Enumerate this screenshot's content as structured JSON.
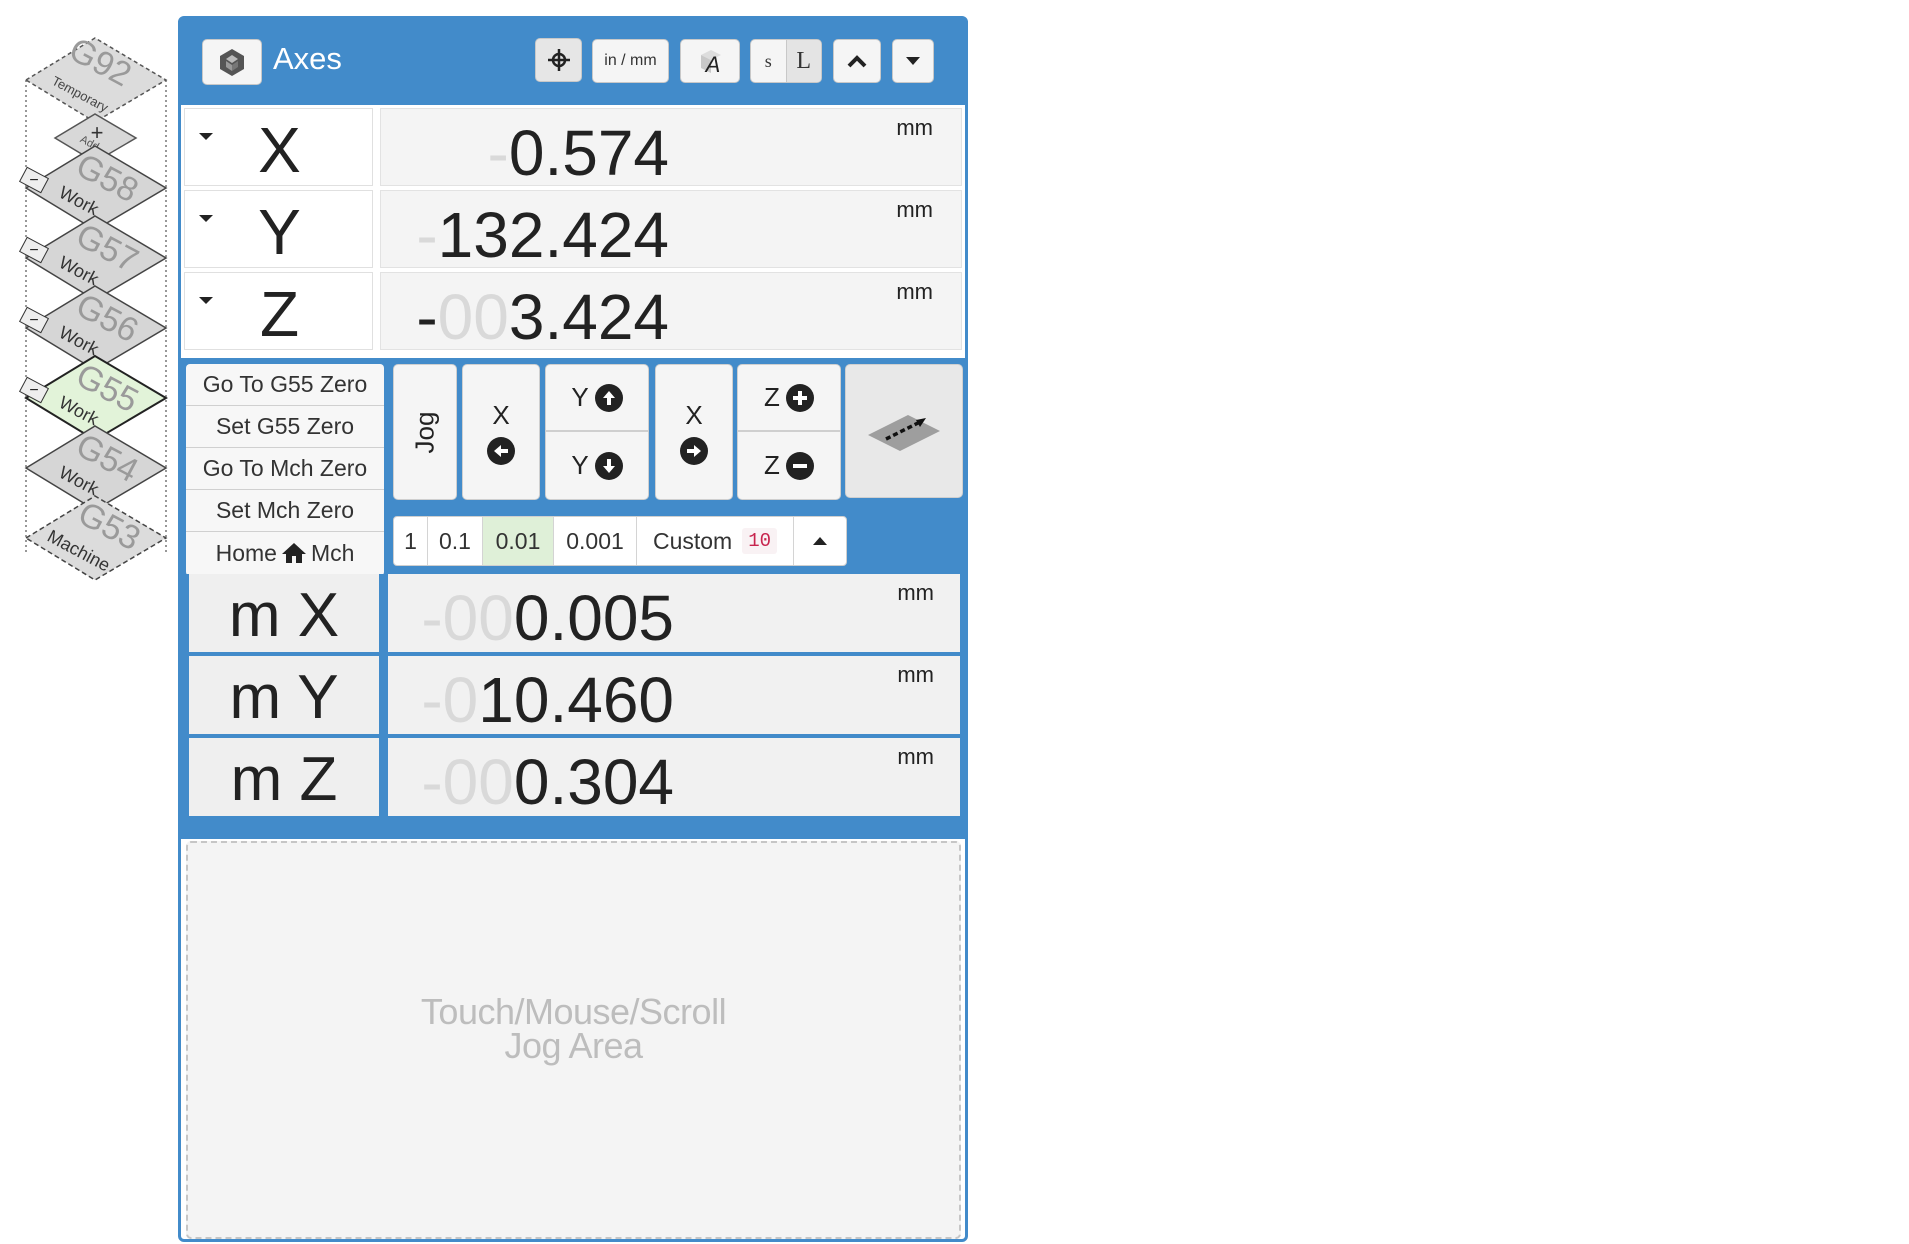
{
  "header": {
    "title": "Axes",
    "units_label": "in / mm",
    "size_small": "s",
    "size_large": "L"
  },
  "offset_stack": [
    {
      "code": "G92",
      "label": "Temporary",
      "style": "dashed"
    },
    {
      "code": "+",
      "label": "Add",
      "style": "add"
    },
    {
      "code": "G58",
      "label": "Work",
      "style": "work"
    },
    {
      "code": "G57",
      "label": "Work",
      "style": "work"
    },
    {
      "code": "G56",
      "label": "Work",
      "style": "work"
    },
    {
      "code": "G55",
      "label": "Work",
      "style": "active"
    },
    {
      "code": "G54",
      "label": "Work",
      "style": "work"
    },
    {
      "code": "G53",
      "label": "Machine",
      "style": "dashed"
    }
  ],
  "work_axes": [
    {
      "name": "X",
      "prefix": "-",
      "value": "0.574",
      "unit": "mm"
    },
    {
      "name": "Y",
      "prefix": "-",
      "value": "132.424",
      "unit": "mm"
    },
    {
      "name": "Z",
      "prefix_strong": "-",
      "prefix": "00",
      "value": "3.424",
      "unit": "mm"
    }
  ],
  "zero_buttons": [
    "Go To G55 Zero",
    "Set G55 Zero",
    "Go To Mch Zero",
    "Set Mch Zero"
  ],
  "home_button": {
    "left": "Home",
    "right": "Mch"
  },
  "jog": {
    "label": "Jog",
    "x_minus": "X",
    "x_plus": "X",
    "y_plus": "Y",
    "y_minus": "Y",
    "z_plus": "Z",
    "z_minus": "Z"
  },
  "steps": {
    "items": [
      "1",
      "0.1",
      "0.01",
      "0.001"
    ],
    "active": "0.01",
    "custom_label": "Custom",
    "custom_value": "10"
  },
  "machine_axes": [
    {
      "name": "m X",
      "prefix": "-00",
      "value": "0.005",
      "unit": "mm"
    },
    {
      "name": "m Y",
      "prefix": "-0",
      "value": "10.460",
      "unit": "mm"
    },
    {
      "name": "m Z",
      "prefix": "-00",
      "value": "0.304",
      "unit": "mm"
    }
  ],
  "touch_area": {
    "line1": "Touch/Mouse/Scroll",
    "line2": "Jog Area"
  },
  "colors": {
    "accent": "#428bca",
    "active_step": "#dff0d8",
    "active_offset": "#e2f3d9"
  }
}
